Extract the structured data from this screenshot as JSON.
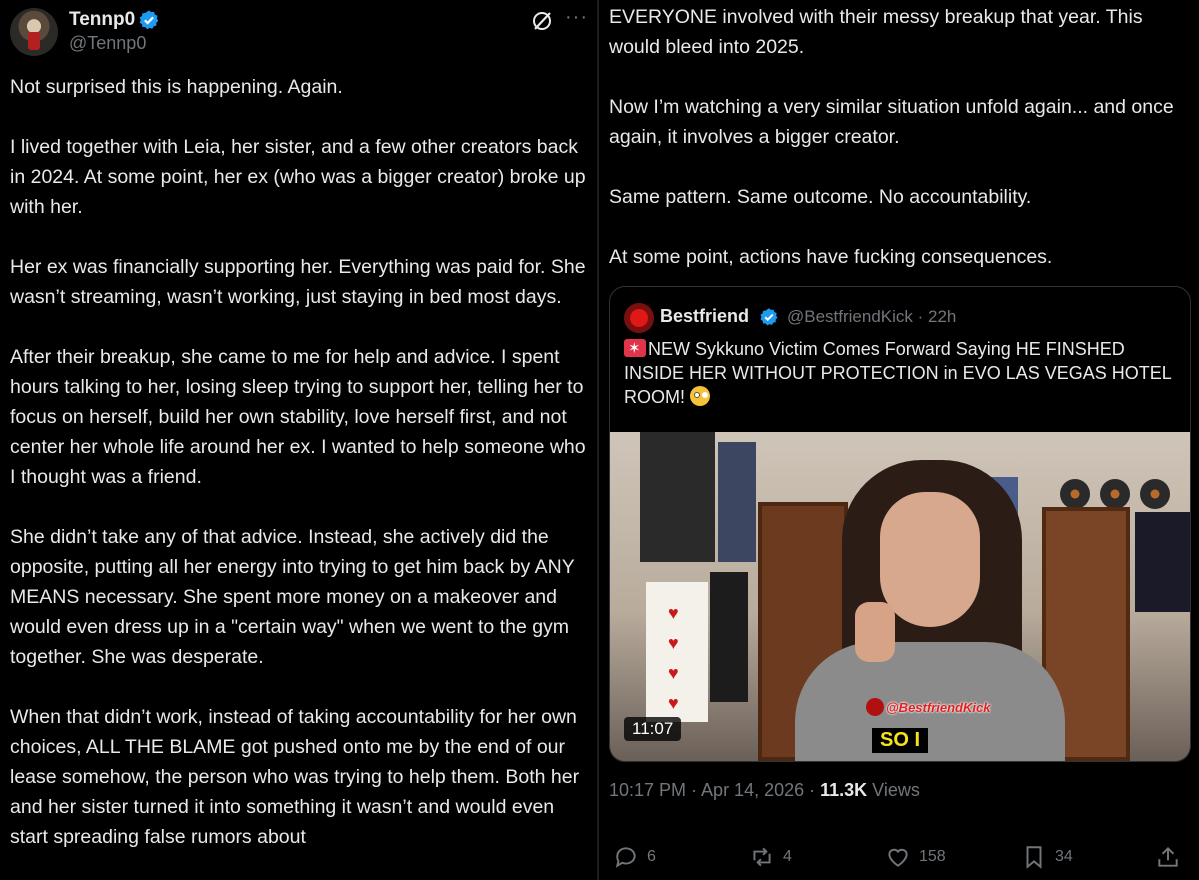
{
  "tweet": {
    "display_name": "Tennp0",
    "handle": "@Tennp0",
    "paragraphs": [
      "Not surprised this is happening. Again.",
      "I lived together with Leia, her sister, and a few other creators back in 2024. At some point, her ex (who was a bigger creator) broke up with her.",
      "Her ex was financially supporting her. Everything was paid for. She wasn’t streaming, wasn’t working, just staying in bed most days.",
      "After their breakup, she came to me for help and advice. I spent hours talking to her, losing sleep trying to support her, telling her to focus on herself, build her own stability, love herself first, and not center her whole life around her ex. I wanted to help someone who I thought was a friend.",
      "She didn’t take any of that advice. Instead, she actively did the opposite, putting all her energy into trying to get him back by ANY MEANS necessary. She spent more money on a makeover and would even dress up in a \"certain way\" when we went to the gym together. She was desperate.",
      "When that didn’t work, instead of taking accountability for her own choices, ALL THE BLAME got pushed onto me by the end of our lease somehow, the person who was trying to help them. Both her and her sister turned it into something it wasn’t and would even start spreading false rumors about"
    ],
    "continuation": [
      "EVERYONE involved with their messy breakup that year. This would bleed into 2025.",
      "Now I’m watching a very similar situation unfold again... and once again, it involves a bigger creator.",
      "Same pattern. Same outcome. No accountability.",
      "At some point, actions have fucking consequences."
    ],
    "timestamp": "10:17 PM · Apr 14, 2026 · ",
    "views_count": "11.3K",
    "views_label": " Views"
  },
  "quote": {
    "display_name": "Bestfriend",
    "handle_time": "@BestfriendKick · 22h",
    "text": "NEW Sykkuno Victim Comes Forward Saying HE FINSHED INSIDE HER WITHOUT PROTECTION in EVO LAS VEGAS HOTEL ROOM! ",
    "video_duration": "11:07",
    "watermark": "@BestfriendKick",
    "caption": "SO I"
  },
  "actions": {
    "replies": "6",
    "reposts": "4",
    "likes": "158",
    "bookmarks": "34"
  },
  "colors": {
    "background": "#000000",
    "text": "#e7e9ea",
    "muted": "#71767b",
    "verified": "#1d9bf0"
  }
}
